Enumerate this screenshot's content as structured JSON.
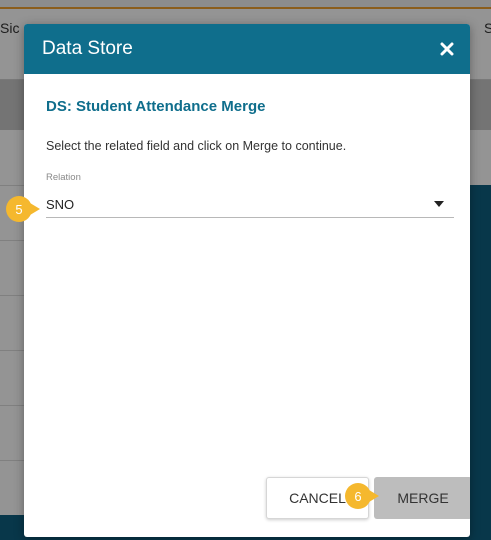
{
  "background": {
    "left_header_text": "Sic",
    "right_header_text": "S"
  },
  "dialog": {
    "title": "Data Store",
    "close_icon": "close-icon",
    "datastore_title": "DS: Student Attendance Merge",
    "instruction": "Select the related field and click on Merge to continue.",
    "relation_label": "Relation",
    "relation_value": "SNO",
    "cancel_label": "CANCEL",
    "merge_label": "MERGE"
  },
  "callouts": {
    "relation": "5",
    "merge": "6"
  },
  "colors": {
    "header": "#0f6e8c",
    "accent": "#f5b82e",
    "merge_button": "#bdbdbd"
  }
}
